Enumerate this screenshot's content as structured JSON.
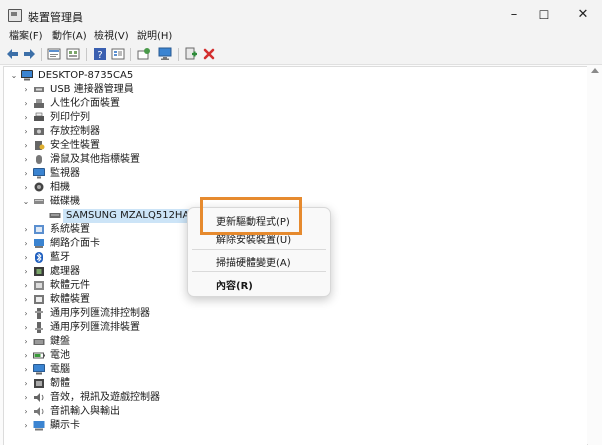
{
  "window": {
    "title": "裝置管理員",
    "controls": [
      "–",
      "☐",
      "✕"
    ]
  },
  "menu": [
    "檔案(F)",
    "動作(A)",
    "檢視(V)",
    "說明(H)"
  ],
  "toolbar_icons": [
    "back-arrow-icon",
    "forward-arrow-icon",
    "properties-icon",
    "show-hidden-icon",
    "help-icon",
    "view-icon",
    "scan-hardware-icon",
    "monitor-icon",
    "update-driver-icon",
    "uninstall-icon"
  ],
  "tree": {
    "root": "DESKTOP-8735CA5",
    "root_expander": "⌄",
    "collapsed_expander": "›",
    "expanded_expander": "⌄",
    "items": [
      {
        "label": "USB 連接器管理員",
        "expanded": false,
        "icon": "usb-connector-icon"
      },
      {
        "label": "人性化介面裝置",
        "expanded": false,
        "icon": "hid-icon"
      },
      {
        "label": "列印佇列",
        "expanded": false,
        "icon": "printer-icon"
      },
      {
        "label": "存放控制器",
        "expanded": false,
        "icon": "storage-controller-icon"
      },
      {
        "label": "安全性裝置",
        "expanded": false,
        "icon": "security-device-icon"
      },
      {
        "label": "滑鼠及其他指標裝置",
        "expanded": false,
        "icon": "mouse-icon"
      },
      {
        "label": "監視器",
        "expanded": false,
        "icon": "monitor-icon"
      },
      {
        "label": "相機",
        "expanded": false,
        "icon": "camera-icon"
      },
      {
        "label": "磁碟機",
        "expanded": true,
        "icon": "disk-drive-icon"
      },
      {
        "label": "SAMSUNG MZALQ512HALU",
        "child": true,
        "selected": true,
        "icon": "ssd-icon"
      },
      {
        "label": "系統裝置",
        "expanded": false,
        "icon": "system-device-icon"
      },
      {
        "label": "網路介面卡",
        "expanded": false,
        "icon": "network-adapter-icon"
      },
      {
        "label": "藍牙",
        "expanded": false,
        "icon": "bluetooth-icon"
      },
      {
        "label": "處理器",
        "expanded": false,
        "icon": "processor-icon"
      },
      {
        "label": "軟體元件",
        "expanded": false,
        "icon": "software-component-icon"
      },
      {
        "label": "軟體裝置",
        "expanded": false,
        "icon": "software-device-icon"
      },
      {
        "label": "通用序列匯流排控制器",
        "expanded": false,
        "icon": "usb-controller-icon"
      },
      {
        "label": "通用序列匯流排裝置",
        "expanded": false,
        "icon": "usb-device-icon"
      },
      {
        "label": "鍵盤",
        "expanded": false,
        "icon": "keyboard-icon"
      },
      {
        "label": "電池",
        "expanded": false,
        "icon": "battery-icon"
      },
      {
        "label": "電腦",
        "expanded": false,
        "icon": "computer-icon"
      },
      {
        "label": "韌體",
        "expanded": false,
        "icon": "firmware-icon"
      },
      {
        "label": "音效，視訊及遊戲控制器",
        "expanded": false,
        "icon": "sound-icon"
      },
      {
        "label": "音訊輸入與輸出",
        "expanded": false,
        "icon": "audio-io-icon"
      },
      {
        "label": "顯示卡",
        "expanded": false,
        "icon": "display-adapter-icon"
      }
    ]
  },
  "context_menu": {
    "items": [
      {
        "label": "更新驅動程式(P)",
        "bold": false
      },
      {
        "label": "解除安裝裝置(U)",
        "bold": false
      },
      {
        "label": "掃描硬體變更(A)",
        "bold": false
      },
      {
        "label": "內容(R)",
        "bold": true
      }
    ]
  },
  "colors": {
    "highlight_box": "#e68a2e",
    "selection": "#cce4f7",
    "uninstall_red": "#d32f2f",
    "update_green": "#2e8b3a"
  }
}
